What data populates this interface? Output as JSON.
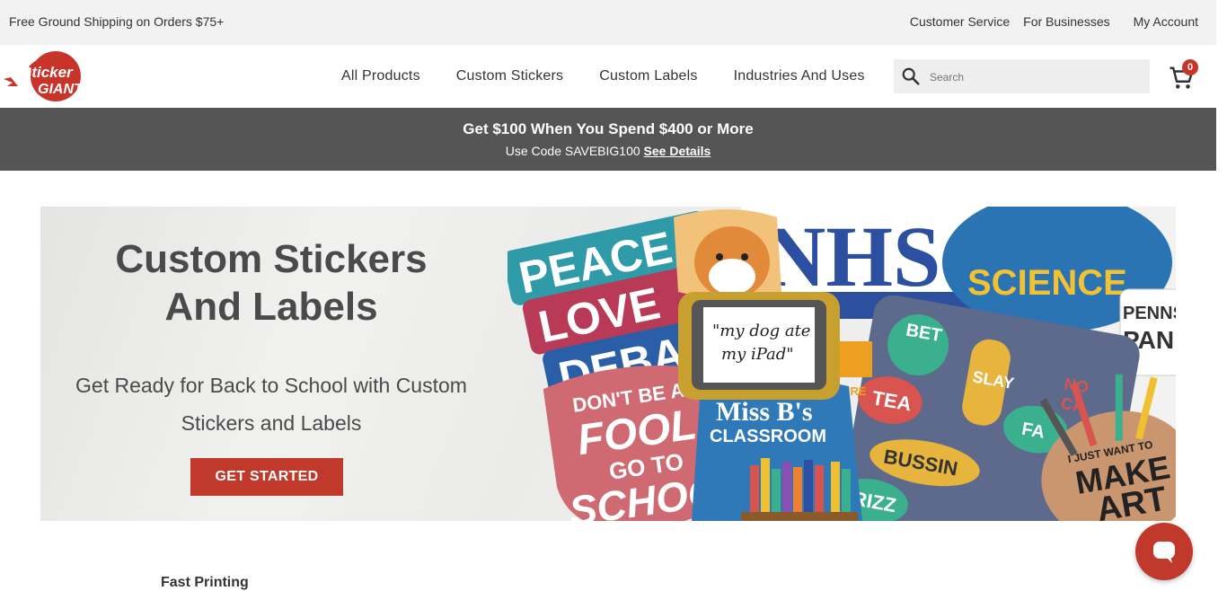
{
  "topbar": {
    "promo": "Free Ground Shipping on Orders $75+",
    "links": [
      "Customer Service",
      "For Businesses",
      "My Account"
    ]
  },
  "header": {
    "logo_text": [
      "Sticker",
      "GIANT"
    ],
    "nav": [
      "All Products",
      "Custom Stickers",
      "Custom Labels",
      "Industries And Uses"
    ],
    "search_placeholder": "Search",
    "cart_count": "0"
  },
  "banner": {
    "headline": "Get $100 When You Spend $400 or More",
    "code_text": "Use Code SAVEBIG100",
    "details_link": "See Details"
  },
  "hero": {
    "title_line1": "Custom Stickers",
    "title_line2": "And Labels",
    "subtitle": "Get Ready for Back to School with Custom Stickers and Labels",
    "cta": "GET STARTED",
    "stickers": {
      "peace": [
        "PEACE",
        "LOVE",
        "DEBATE"
      ],
      "nhs": "NHS",
      "science": "SCIENCE",
      "dog": [
        "\"my dog ate",
        "my iPad\""
      ],
      "classroom": [
        "Miss B's",
        "CLASSROOM"
      ],
      "fool": [
        "DON'T BE A",
        "FOOL,",
        "GO TO",
        "SCHOOL!"
      ],
      "slang": [
        "BET",
        "SLAY",
        "TEA",
        "BUSSIN",
        "RIZZ",
        "FA"
      ],
      "art": [
        "I JUST WANT TO",
        "MAKE",
        "ART"
      ],
      "penn": [
        "PENNS",
        "PAN"
      ],
      "no_cap": [
        "NO",
        "CA"
      ],
      "ure": "URE"
    }
  },
  "feature_heading": "Fast Printing",
  "colors": {
    "accent": "#c0392b",
    "banner": "#555555",
    "topbar": "#f2f2f2"
  }
}
